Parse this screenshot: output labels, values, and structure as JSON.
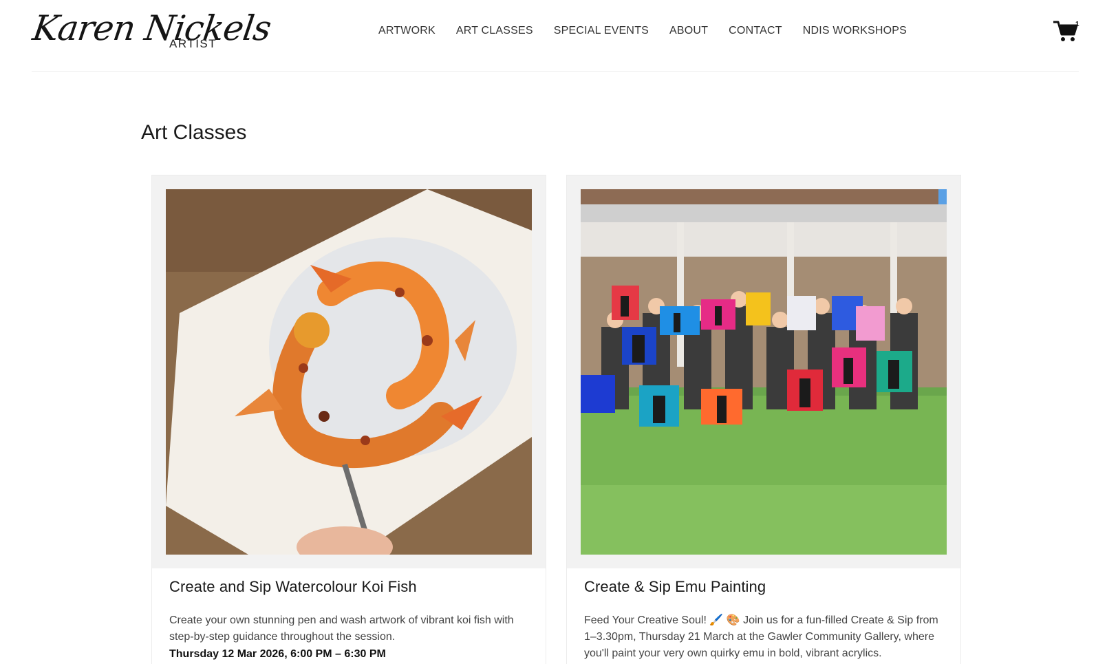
{
  "header": {
    "logo_script": "Karen Nickels",
    "logo_sub": "ARTIST",
    "nav": [
      {
        "label": "ARTWORK"
      },
      {
        "label": "ART CLASSES"
      },
      {
        "label": "SPECIAL EVENTS"
      },
      {
        "label": "ABOUT"
      },
      {
        "label": "CONTACT"
      },
      {
        "label": "NDIS WORKSHOPS"
      }
    ],
    "cart_count": "1"
  },
  "main": {
    "title": "Art Classes",
    "cards": [
      {
        "title": "Create and Sip Watercolour Koi Fish",
        "description": "Create your own stunning pen and wash artwork of vibrant koi fish with step-by-step guidance throughout the session.",
        "date": "Thursday 12 Mar 2026, 6:00 PM – 6:30 PM"
      },
      {
        "title": "Create & Sip Emu Painting",
        "description": "Feed Your Creative Soul! 🖌️ 🎨 Join us for a fun-filled Create & Sip from 1–3.30pm, Thursday 21 March at the Gawler Community Gallery, where you'll paint your very own quirky emu in bold, vibrant acrylics."
      }
    ]
  }
}
